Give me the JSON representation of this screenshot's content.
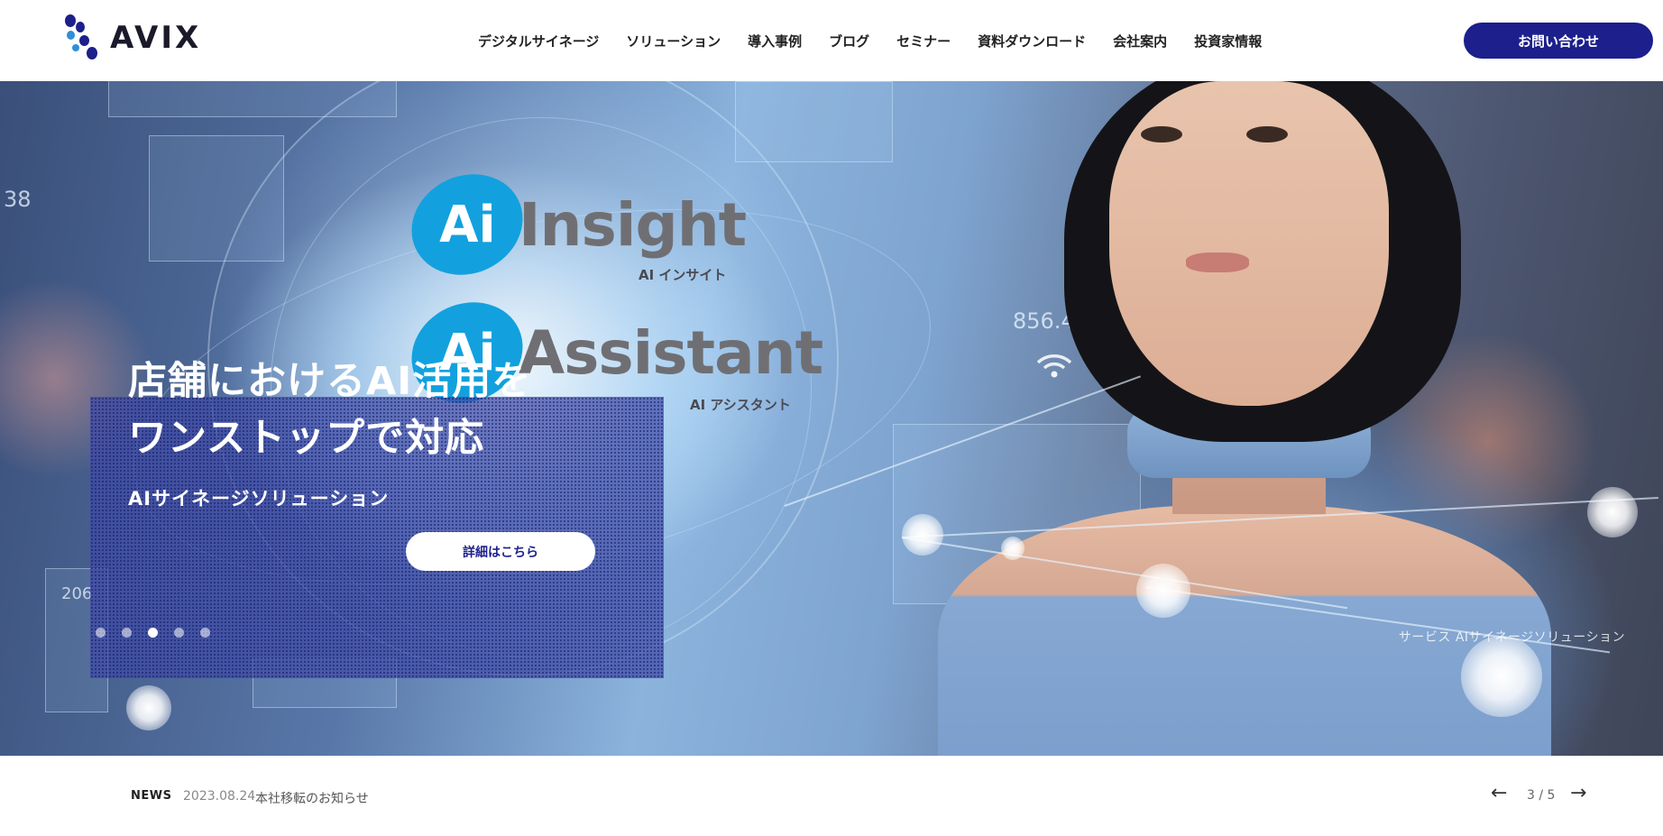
{
  "header": {
    "logo_text": "AVIX",
    "nav": [
      {
        "label": "デジタルサイネージ"
      },
      {
        "label": "ソリューション"
      },
      {
        "label": "導入事例"
      },
      {
        "label": "ブログ"
      },
      {
        "label": "セミナー"
      },
      {
        "label": "資料ダウンロード"
      },
      {
        "label": "会社案内"
      },
      {
        "label": "投資家情報"
      }
    ],
    "contact_label": "お問い合わせ"
  },
  "hero": {
    "logos": [
      {
        "badge": "Ai",
        "word": "Insight",
        "sub": "AI インサイト"
      },
      {
        "badge": "Ai",
        "word": "Assistant",
        "sub": "AI アシスタント"
      }
    ],
    "hud_numbers": [
      "38",
      "856.49",
      "206"
    ],
    "title_line1": "店舗におけるAI活用を",
    "title_line2": "ワンストップで対応",
    "subtitle": "AIサイネージソリューション",
    "detail_button": "詳細はこちら",
    "slide_count": 5,
    "active_slide": 3,
    "caption": "サービス AIサイネージソリューション"
  },
  "news": {
    "label": "NEWS",
    "date": "2023.08.24",
    "title": "本社移転のお知らせ",
    "counter": "3 / 5",
    "prev_icon": "←",
    "next_icon": "→"
  },
  "colors": {
    "brand_navy": "#1c1f8c",
    "ai_badge_blue": "#12a1de",
    "card_overlay": "#3e4aa8"
  },
  "icons": [
    "logo-mark",
    "arrow-left-icon",
    "arrow-right-icon",
    "wifi-icon"
  ]
}
